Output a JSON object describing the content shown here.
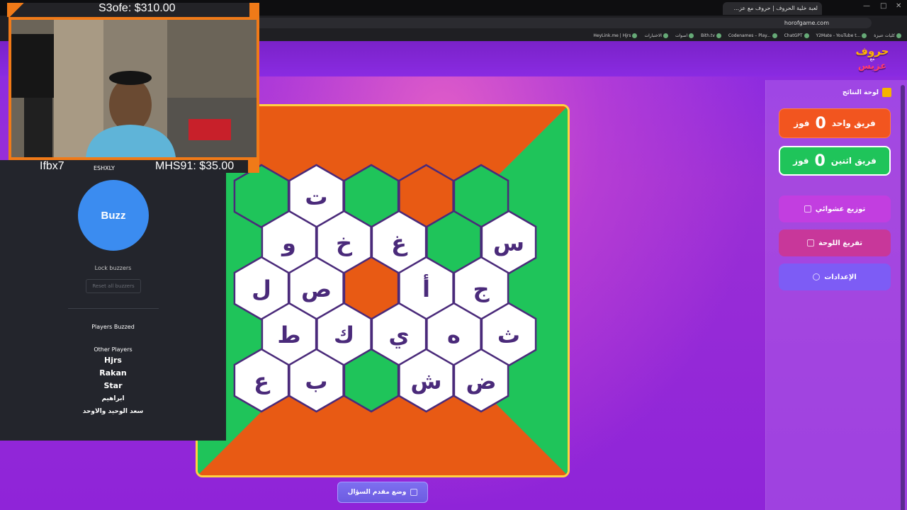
{
  "browser": {
    "tab_title": "لعبة خلية الحروف | حروف مع عز...",
    "url": "horofgame.com",
    "bookmarks": [
      "كليات عنيزة",
      "Y2Mate - YouTube t...",
      "ChatGPT",
      "Codenames – Play...",
      "Bith.tv",
      "اصوات",
      "الاختبارات",
      "HeyLink.me | Hjrs"
    ]
  },
  "overlay": {
    "donation_top": "S3ofe: $310.00",
    "donation_bottom_left": "Ifbx7",
    "donation_bottom_right": "MHS91: $35.00",
    "partial_name": "ESHXLY"
  },
  "buzzer": {
    "buzz_label": "Buzz",
    "lock_label": "Lock buzzers",
    "reset_label": "Reset all buzzers",
    "players_buzzed_label": "Players Buzzed",
    "other_players_label": "Other Players",
    "players": [
      "Hjrs",
      "Rakan",
      "Star",
      "ابراهيم",
      "سعد الوحيد والاوحد"
    ]
  },
  "logo": {
    "line1": "حروف",
    "line2": "مع",
    "line3": "عزيس"
  },
  "panel": {
    "results_title": "لوحة النتائج",
    "team1": {
      "name": "فريق واحد",
      "score": "0",
      "unit": "فوز",
      "color": "#f2551f"
    },
    "team2": {
      "name": "فريق اثنين",
      "score": "0",
      "unit": "فوز",
      "color": "#1fc45a"
    },
    "random_label": "توزيع عشوائي",
    "clear_label": "تفريغ اللوحة",
    "settings_label": "الإعدادات"
  },
  "host_button": "وضع مقدم السؤال",
  "board": {
    "colors": {
      "white": "#ffffff",
      "green": "#1fc45a",
      "orange": "#e85a14",
      "outline": "#4a2a7a",
      "letter": "#4a2a7a"
    },
    "rows": [
      [
        {
          "t": "",
          "c": "green"
        },
        {
          "t": "ت",
          "c": "white"
        },
        {
          "t": "",
          "c": "green"
        },
        {
          "t": "",
          "c": "orange"
        },
        {
          "t": "",
          "c": "green"
        }
      ],
      [
        {
          "t": "و",
          "c": "white"
        },
        {
          "t": "خ",
          "c": "white"
        },
        {
          "t": "غ",
          "c": "white"
        },
        {
          "t": "",
          "c": "green"
        },
        {
          "t": "س",
          "c": "white"
        }
      ],
      [
        {
          "t": "ل",
          "c": "white"
        },
        {
          "t": "ص",
          "c": "white"
        },
        {
          "t": "",
          "c": "orange"
        },
        {
          "t": "أ",
          "c": "white"
        },
        {
          "t": "ج",
          "c": "white"
        }
      ],
      [
        {
          "t": "ط",
          "c": "white"
        },
        {
          "t": "ك",
          "c": "white"
        },
        {
          "t": "ي",
          "c": "white"
        },
        {
          "t": "ه",
          "c": "white"
        },
        {
          "t": "ث",
          "c": "white"
        }
      ],
      [
        {
          "t": "ع",
          "c": "white"
        },
        {
          "t": "ب",
          "c": "white"
        },
        {
          "t": "",
          "c": "green"
        },
        {
          "t": "ش",
          "c": "white"
        },
        {
          "t": "ض",
          "c": "white"
        }
      ]
    ]
  }
}
